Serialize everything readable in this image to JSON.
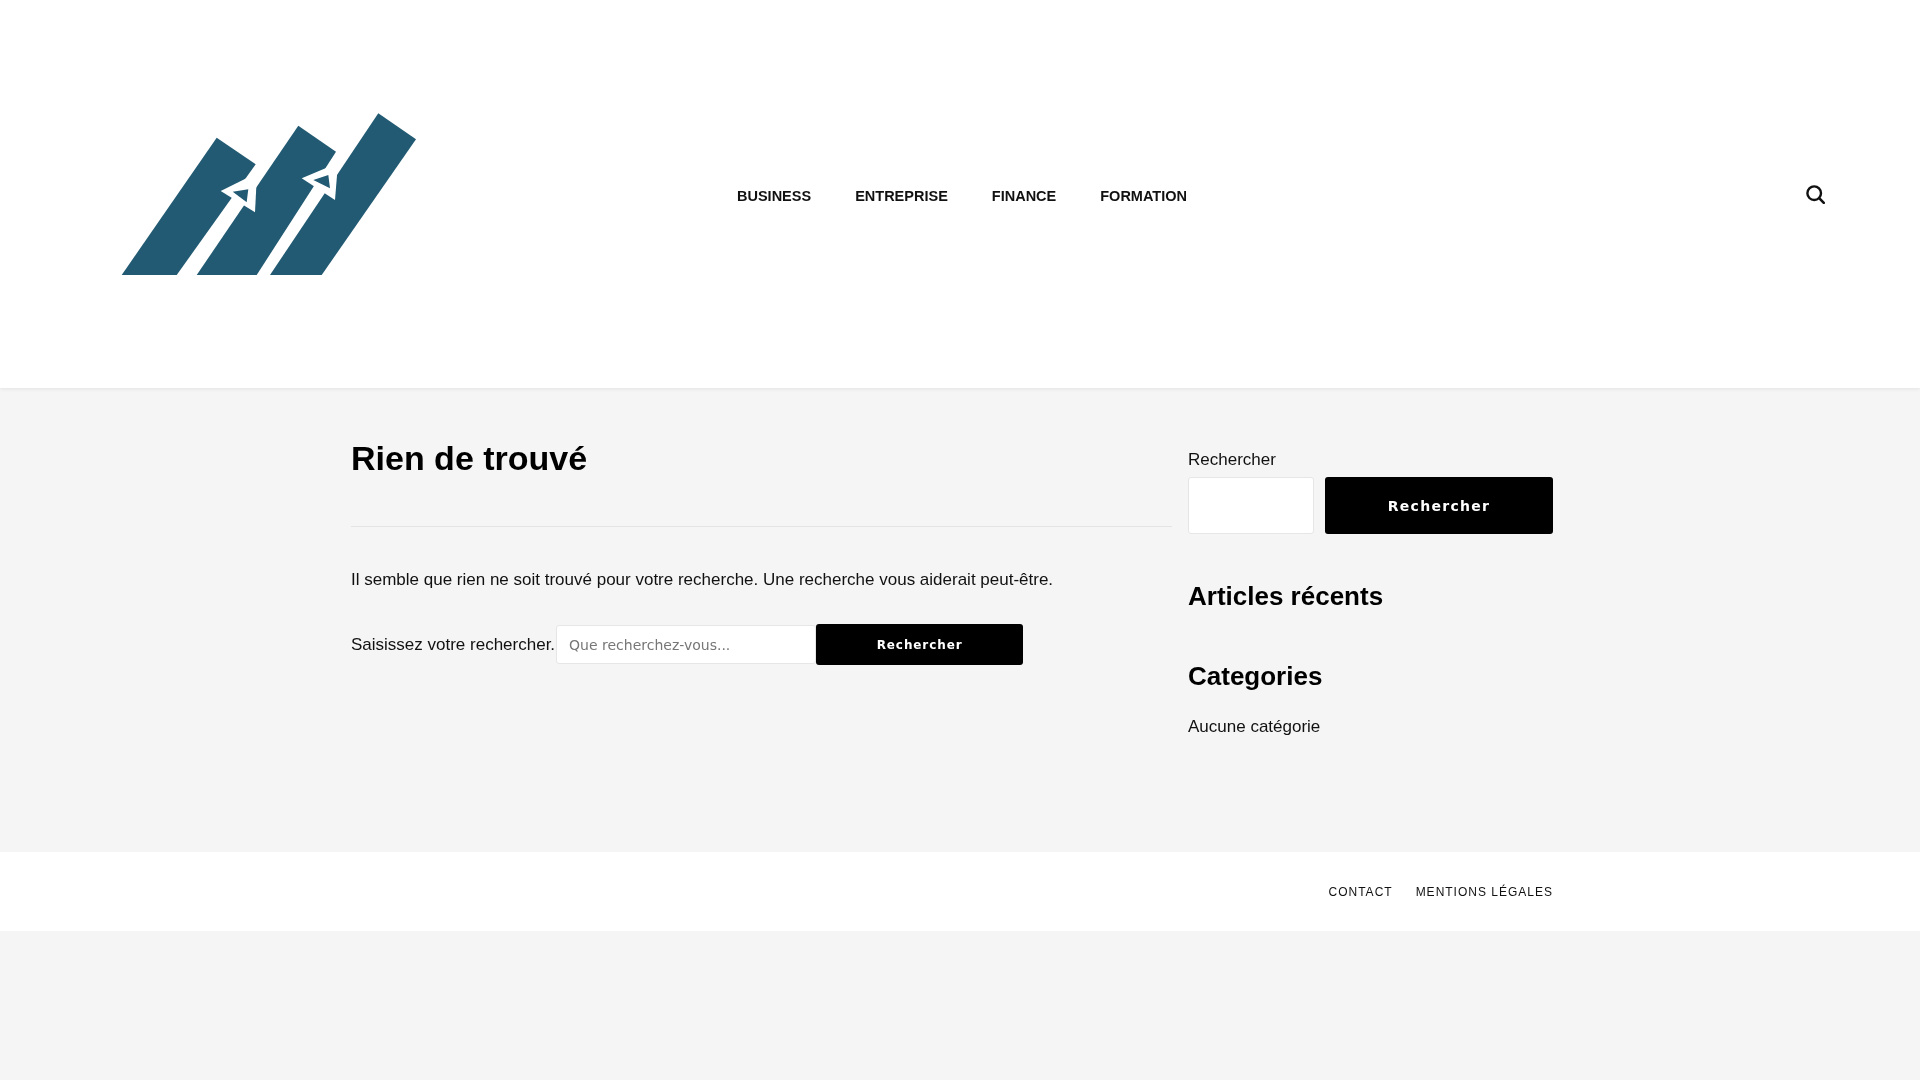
{
  "header": {
    "nav": [
      {
        "label": "BUSINESS"
      },
      {
        "label": "ENTREPRISE"
      },
      {
        "label": "FINANCE"
      },
      {
        "label": "FORMATION"
      }
    ]
  },
  "main": {
    "title": "Rien de trouvé",
    "message": "Il semble que rien ne soit trouvé pour votre recherche. Une recherche vous aiderait peut-être.",
    "search_form": {
      "label": "Saisissez votre rechercher.",
      "placeholder": "Que recherchez-vous...",
      "button": "Rechercher"
    }
  },
  "sidebar": {
    "search": {
      "label": "Rechercher",
      "button": "Rechercher"
    },
    "widgets": [
      {
        "title": "Articles récents"
      },
      {
        "title": "Categories",
        "items": [
          "Aucune catégorie"
        ]
      }
    ]
  },
  "footer": {
    "links": [
      "CONTACT",
      "MENTIONS LÉGALES"
    ]
  }
}
